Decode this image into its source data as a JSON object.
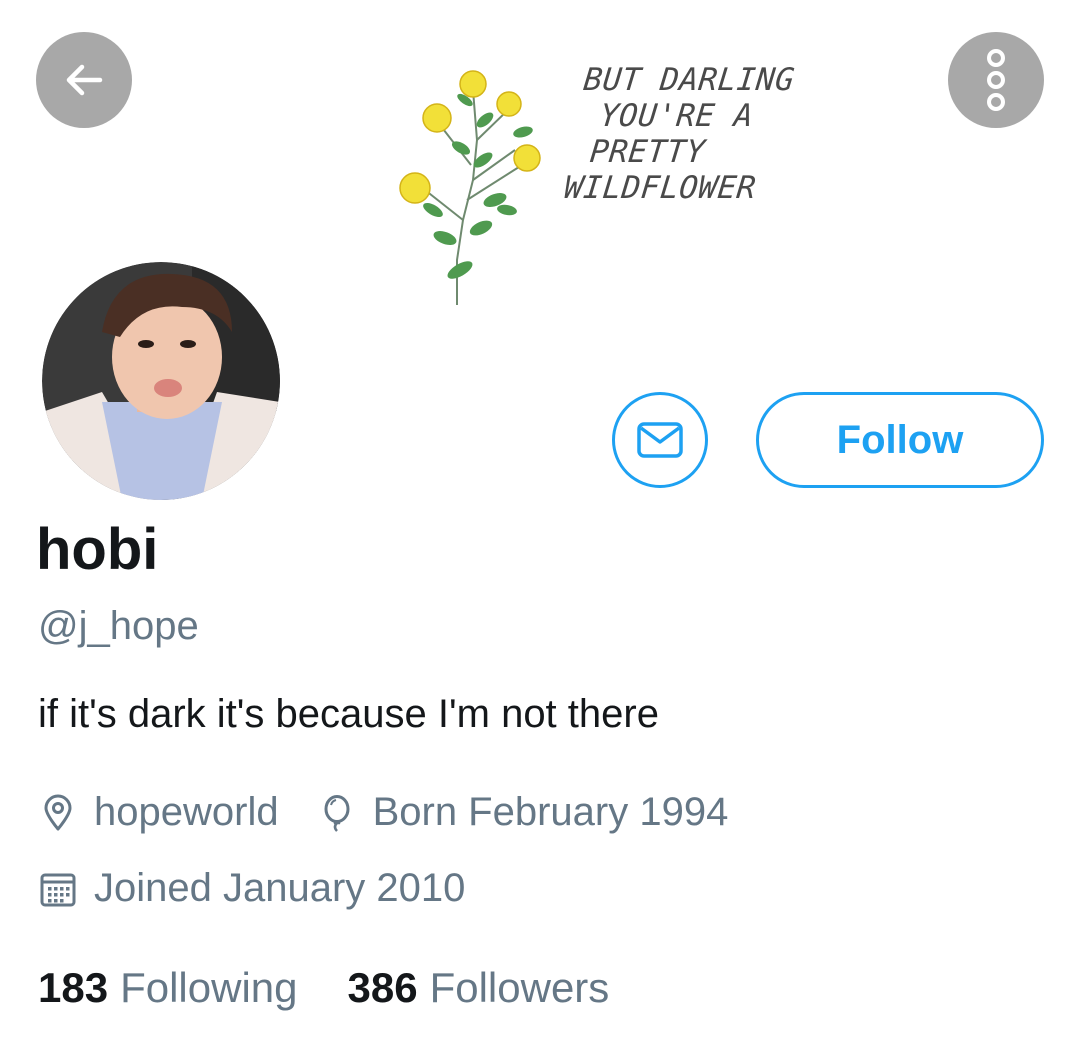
{
  "banner": {
    "quote_lines": [
      "BUT DARLING",
      "YOU'RE A",
      "PRETTY",
      "WILDFLOWER"
    ]
  },
  "profile": {
    "name": "hobi",
    "handle": "@j_hope",
    "bio": "if it's dark it's because I'm not there",
    "location": "hopeworld",
    "birthday": "Born February 1994",
    "joined": "Joined January 2010",
    "following_count": "183",
    "following_label": "Following",
    "followers_count": "386",
    "followers_label": "Followers"
  },
  "actions": {
    "follow_label": "Follow"
  },
  "colors": {
    "accent": "#1da1f2",
    "secondary_text": "#657786",
    "primary_text": "#14171a",
    "icon_button_bg": "#a8a8a8"
  },
  "icons": {
    "back": "arrow-left-icon",
    "more": "more-vertical-icon",
    "message": "envelope-icon",
    "location": "location-pin-icon",
    "birthday": "balloon-icon",
    "joined": "calendar-icon"
  }
}
